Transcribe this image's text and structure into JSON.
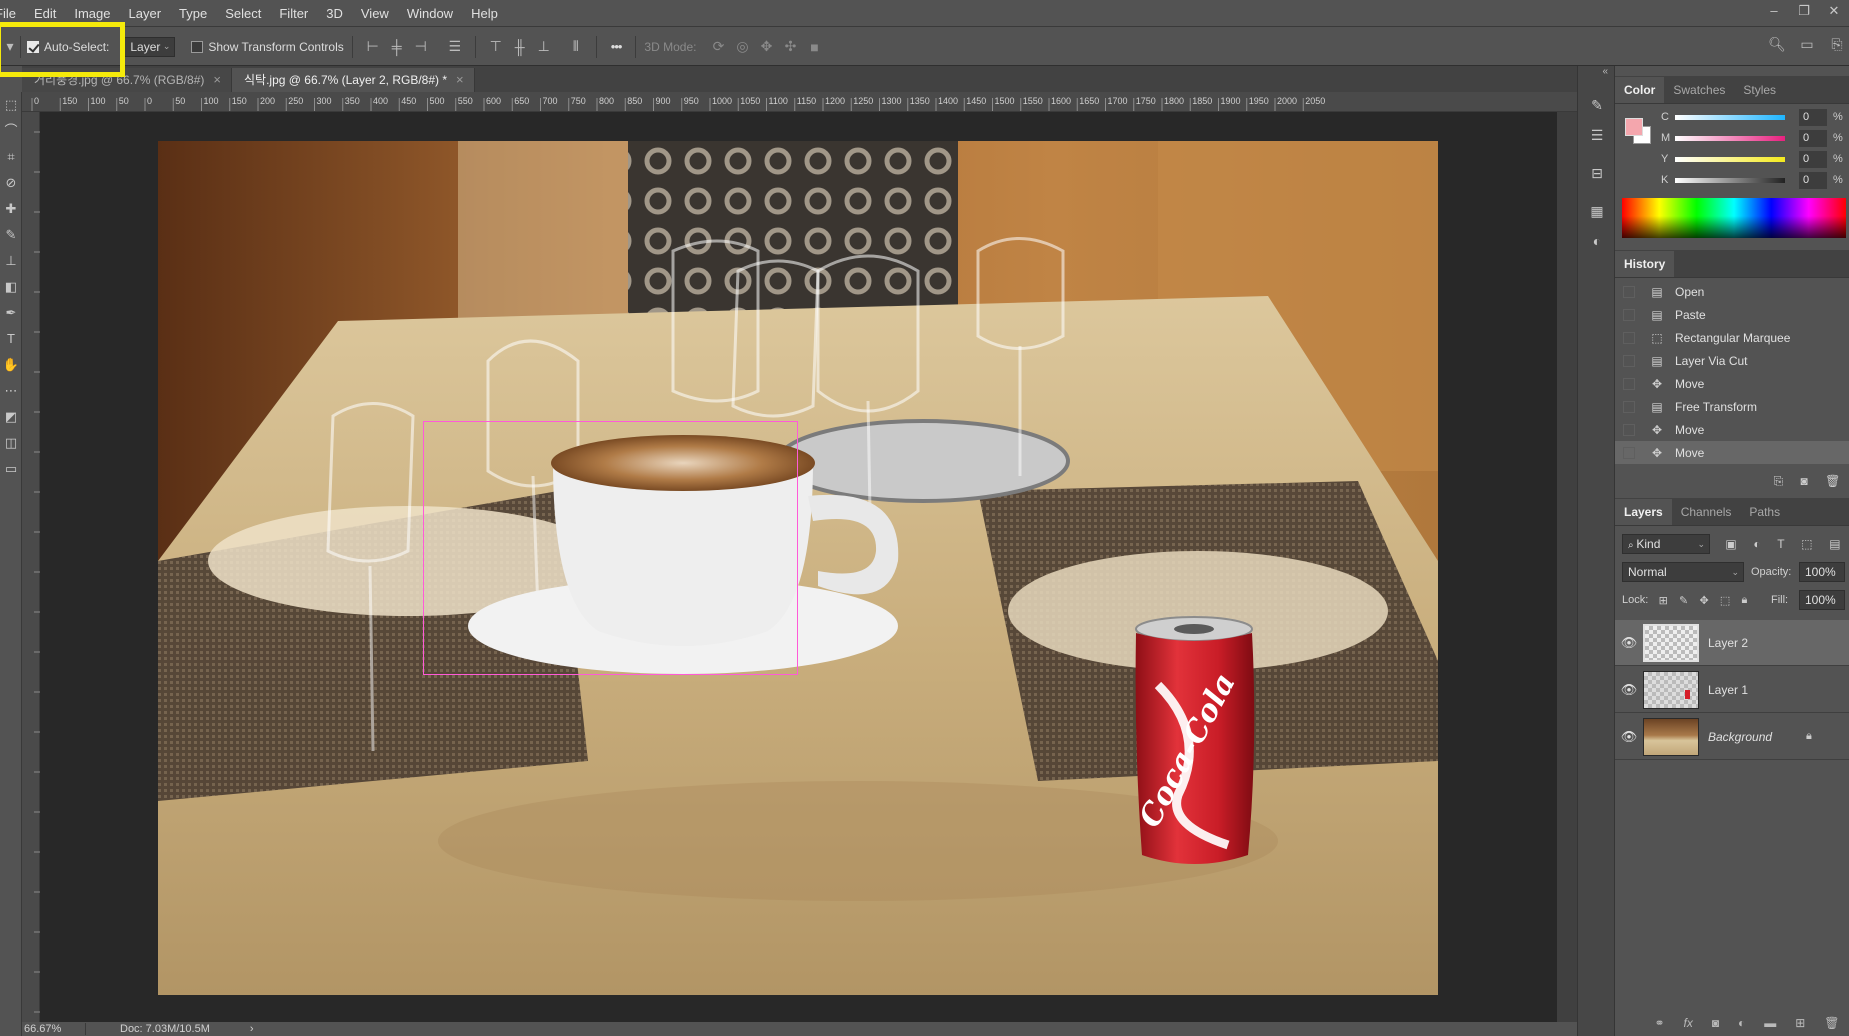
{
  "menu": [
    "File",
    "Edit",
    "Image",
    "Layer",
    "Type",
    "Select",
    "Filter",
    "3D",
    "View",
    "Window",
    "Help"
  ],
  "window_controls": [
    "–",
    "❐",
    "✕"
  ],
  "options_bar": {
    "auto_select_label": "Auto-Select:",
    "auto_select_checked": true,
    "target_value": "Layer",
    "show_transform_label": "Show Transform Controls",
    "more": "•••",
    "mode_3d_label": "3D Mode:"
  },
  "doc_tabs": [
    {
      "label": "거리풍경.jpg @ 66.7% (RGB/8#)",
      "active": false,
      "close": "×"
    },
    {
      "label": "식탁.jpg @ 66.7% (Layer 2, RGB/8#) *",
      "active": true,
      "close": "×"
    }
  ],
  "ruler": {
    "labels": [
      "0",
      "150",
      "100",
      "50",
      "0",
      "50",
      "100",
      "150",
      "200",
      "250",
      "300",
      "350",
      "400",
      "450",
      "500",
      "550",
      "600",
      "650",
      "700",
      "750",
      "800",
      "850",
      "900",
      "950",
      "1000",
      "1050",
      "1100",
      "1150",
      "1200",
      "1250",
      "1300",
      "1350",
      "1400",
      "1450",
      "1500",
      "1550",
      "1600",
      "1650",
      "1700",
      "1750",
      "1800",
      "1850",
      "1900",
      "1950",
      "2000",
      "2050"
    ]
  },
  "status": {
    "zoom": "66.67%",
    "doc": "Doc: 7.03M/10.5M",
    "arrow": "›"
  },
  "canvas": {
    "selection_color": "#ff5ad8",
    "can_text": "Coca-Cola",
    "can_color": "#d51d28"
  },
  "color_panel": {
    "tabs": [
      "Color",
      "Swatches",
      "Styles"
    ],
    "active_tab": "Color",
    "foreground": "#f4a6ad",
    "sliders": [
      {
        "label": "C",
        "value": "0",
        "unit": "%",
        "gradient": "#1fb5ff"
      },
      {
        "label": "M",
        "value": "0",
        "unit": "%",
        "gradient": "#e8217f"
      },
      {
        "label": "Y",
        "value": "0",
        "unit": "%",
        "gradient": "#f4ea1d"
      },
      {
        "label": "K",
        "value": "0",
        "unit": "%",
        "gradient": "#222222"
      }
    ]
  },
  "history_panel": {
    "title": "History",
    "items": [
      {
        "label": "Open",
        "icon": "document-icon"
      },
      {
        "label": "Paste",
        "icon": "document-icon"
      },
      {
        "label": "Rectangular Marquee",
        "icon": "marquee-icon"
      },
      {
        "label": "Layer Via Cut",
        "icon": "document-icon"
      },
      {
        "label": "Move",
        "icon": "move-icon"
      },
      {
        "label": "Free Transform",
        "icon": "document-icon"
      },
      {
        "label": "Move",
        "icon": "move-icon"
      },
      {
        "label": "Move",
        "icon": "move-icon"
      }
    ],
    "selected_index": 7
  },
  "layers_panel": {
    "tabs": [
      "Layers",
      "Channels",
      "Paths"
    ],
    "active_tab": "Layers",
    "filter_label": "Kind",
    "blend_mode": "Normal",
    "opacity_label": "Opacity:",
    "opacity_value": "100%",
    "lock_label": "Lock:",
    "fill_label": "Fill:",
    "fill_value": "100%",
    "layers": [
      {
        "name": "Layer 2",
        "visible": true,
        "locked": false,
        "italic": false
      },
      {
        "name": "Layer 1",
        "visible": true,
        "locked": false,
        "italic": false
      },
      {
        "name": "Background",
        "visible": true,
        "locked": true,
        "italic": true
      }
    ],
    "selected_index": 0
  }
}
